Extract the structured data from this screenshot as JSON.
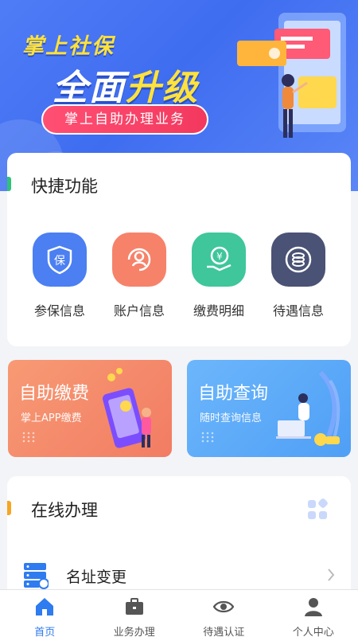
{
  "banner": {
    "title_line1": "掌上社保",
    "title_line2_a": "全面",
    "title_line2_b": "升级",
    "tagline": "掌上自助办理业务"
  },
  "quick": {
    "title": "快捷功能",
    "items": [
      {
        "label": "参保信息",
        "icon": "shield-bao-icon",
        "color": "#4b7ff2"
      },
      {
        "label": "账户信息",
        "icon": "user-refresh-icon",
        "color": "#f6826a"
      },
      {
        "label": "缴费明细",
        "icon": "yen-hand-icon",
        "color": "#3fc69b"
      },
      {
        "label": "待遇信息",
        "icon": "coin-stack-icon",
        "color": "#4a5275"
      }
    ]
  },
  "self_service": {
    "pay": {
      "title": "自助缴费",
      "subtitle": "掌上APP缴费"
    },
    "query": {
      "title": "自助查询",
      "subtitle": "随时查询信息"
    }
  },
  "online": {
    "title": "在线办理",
    "rows": [
      {
        "label": "名址变更",
        "icon": "server-user-icon"
      }
    ]
  },
  "nav": {
    "items": [
      {
        "label": "首页",
        "icon": "home-icon",
        "active": true
      },
      {
        "label": "业务办理",
        "icon": "briefcase-icon",
        "active": false
      },
      {
        "label": "待遇认证",
        "icon": "eye-icon",
        "active": false
      },
      {
        "label": "个人中心",
        "icon": "person-icon",
        "active": false
      }
    ],
    "active_color": "#2f7bf0"
  }
}
